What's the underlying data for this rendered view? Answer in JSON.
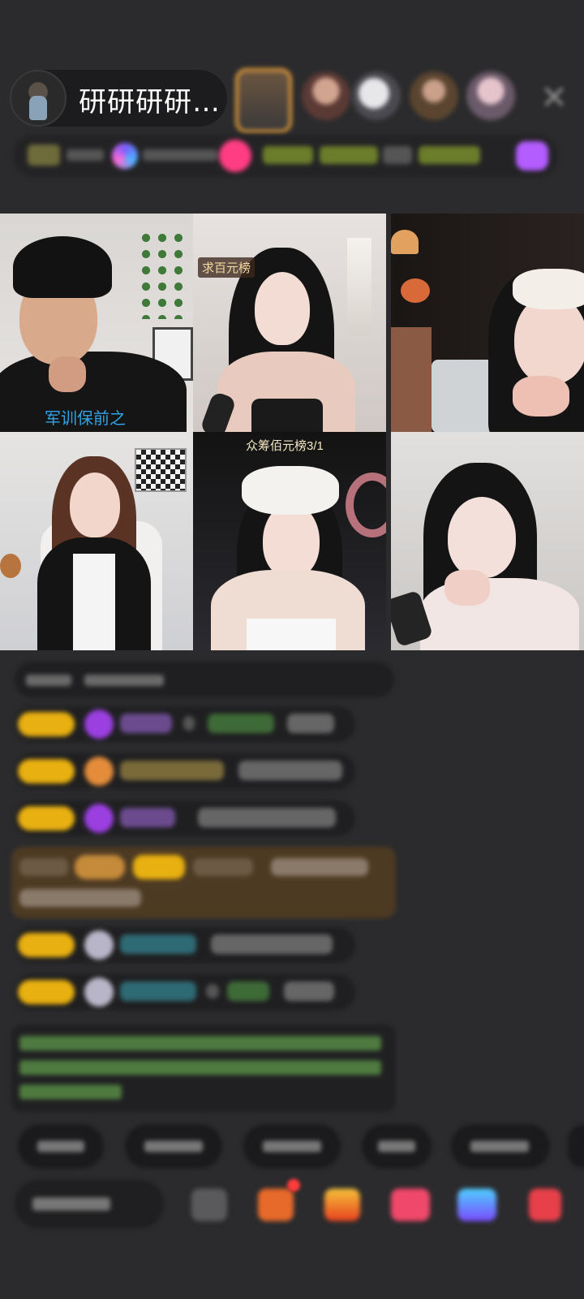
{
  "header": {
    "host_name": "研研研研…",
    "viewer_count": 5,
    "close_label": "close"
  },
  "tiles": [
    {
      "label": "军训保前之"
    },
    {
      "label": "求百元榜"
    },
    {
      "label": ""
    },
    {
      "label": ""
    },
    {
      "label": "众筹佰元榜3/1"
    },
    {
      "label": ""
    }
  ],
  "chat": {
    "message_count": 8,
    "quick_reply_count": 6,
    "tool_count": 6
  },
  "colors": {
    "background": "#2b2b2d",
    "badge": "#e8b010",
    "green_text": "#7bd06a",
    "purple_heart": "#9b3fe0",
    "banner_brown": "#4d3a23"
  }
}
